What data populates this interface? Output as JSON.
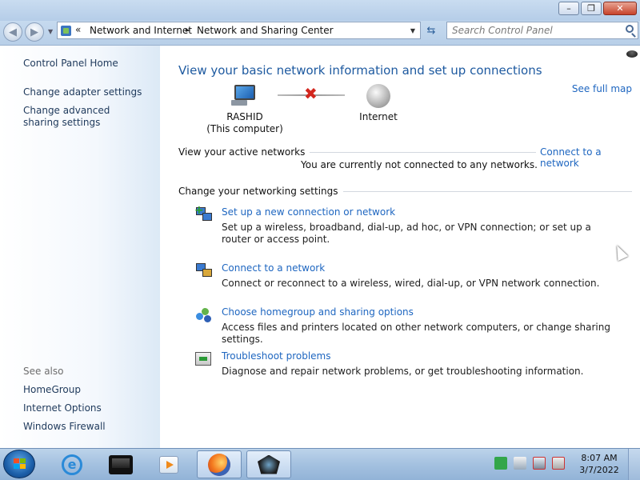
{
  "window": {
    "minimize_label": "–",
    "maximize_label": "❐",
    "close_label": "✕"
  },
  "navigation": {
    "back_icon": "back-arrow-icon",
    "forward_icon": "forward-arrow-icon",
    "address": {
      "chevron": "«",
      "crumbs": [
        "Network and Internet",
        "Network and Sharing Center"
      ],
      "separator": "►"
    },
    "refresh_icon": "refresh-icon",
    "search_placeholder": "Search Control Panel"
  },
  "sidebar": {
    "home": "Control Panel Home",
    "links": [
      "Change adapter settings",
      "Change advanced sharing settings"
    ],
    "see_also_title": "See also",
    "see_also": [
      "HomeGroup",
      "Internet Options",
      "Windows Firewall"
    ]
  },
  "main": {
    "heading": "View your basic network information and set up connections",
    "see_full_map": "See full map",
    "map": {
      "computer_name": "RASHID",
      "computer_sub": "(This computer)",
      "internet_label": "Internet",
      "status": "disconnected"
    },
    "active_networks": {
      "label": "View your active networks",
      "connect_link": "Connect to a network",
      "message": "You are currently not connected to any networks."
    },
    "settings_label": "Change your networking settings",
    "tasks": [
      {
        "link": "Set up a new connection or network",
        "desc": "Set up a wireless, broadband, dial-up, ad hoc, or VPN connection; or set up a router or access point.",
        "icon": "new-connection-icon"
      },
      {
        "link": "Connect to a network",
        "desc": "Connect or reconnect to a wireless, wired, dial-up, or VPN network connection.",
        "icon": "connect-network-icon"
      },
      {
        "link": "Choose homegroup and sharing options",
        "desc": "Access files and printers located on other network computers, or change sharing settings.",
        "icon": "homegroup-icon"
      },
      {
        "link": "Troubleshoot problems",
        "desc": "Diagnose and repair network problems, or get troubleshooting information.",
        "icon": "troubleshoot-icon"
      }
    ]
  },
  "taskbar": {
    "apps": [
      "internet-explorer-icon",
      "monitor-app-icon",
      "media-player-icon",
      "firefox-icon",
      "rashid-app-icon"
    ],
    "clock_time": "8:07 AM",
    "clock_date": "3/7/2022"
  },
  "colors": {
    "link": "#1e66c0",
    "heading": "#1e5aa0",
    "error_x": "#d3261e"
  }
}
